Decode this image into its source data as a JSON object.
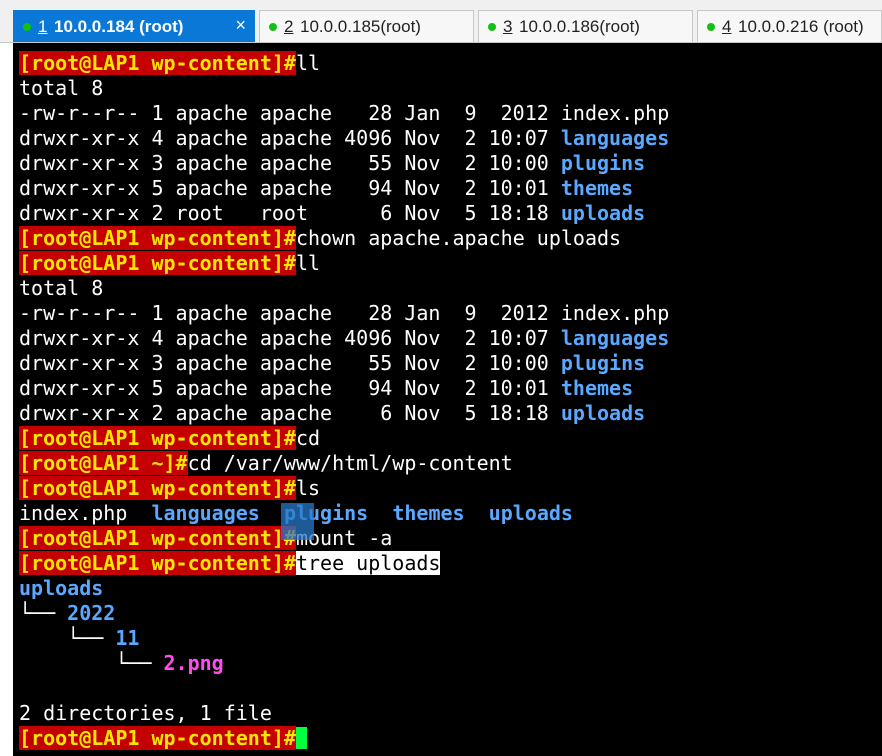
{
  "tabs": [
    {
      "num": "1",
      "title": "10.0.0.184  (root)",
      "active": true,
      "close": "×"
    },
    {
      "num": "2",
      "title": "10.0.0.185(root)",
      "active": false
    },
    {
      "num": "3",
      "title": "10.0.0.186(root)",
      "active": false
    },
    {
      "num": "4",
      "title": "10.0.0.216  (root)",
      "active": false
    }
  ],
  "prompt_wp": "[root@LAP1 wp-content]#",
  "prompt_home": "[root@LAP1 ~]#",
  "cmd1": "ll",
  "total": "total 8",
  "ls1": [
    {
      "perm": "-rw-r--r-- 1 apache apache   28 Jan  9  2012 ",
      "name": "index.php",
      "dir": false
    },
    {
      "perm": "drwxr-xr-x 4 apache apache 4096 Nov  2 10:07 ",
      "name": "languages",
      "dir": true
    },
    {
      "perm": "drwxr-xr-x 3 apache apache   55 Nov  2 10:00 ",
      "name": "plugins",
      "dir": true
    },
    {
      "perm": "drwxr-xr-x 5 apache apache   94 Nov  2 10:01 ",
      "name": "themes",
      "dir": true
    },
    {
      "perm": "drwxr-xr-x 2 root   root      6 Nov  5 18:18 ",
      "name": "uploads",
      "dir": true
    }
  ],
  "cmd2": "chown apache.apache uploads",
  "cmd3": "ll",
  "ls2": [
    {
      "perm": "-rw-r--r-- 1 apache apache   28 Jan  9  2012 ",
      "name": "index.php",
      "dir": false
    },
    {
      "perm": "drwxr-xr-x 4 apache apache 4096 Nov  2 10:07 ",
      "name": "languages",
      "dir": true
    },
    {
      "perm": "drwxr-xr-x 3 apache apache   55 Nov  2 10:00 ",
      "name": "plugins",
      "dir": true
    },
    {
      "perm": "drwxr-xr-x 5 apache apache   94 Nov  2 10:01 ",
      "name": "themes",
      "dir": true
    },
    {
      "perm": "drwxr-xr-x 2 apache apache    6 Nov  5 18:18 ",
      "name": "uploads",
      "dir": true
    }
  ],
  "cmd4": "cd",
  "cmd5": "cd /var/www/html/wp-content",
  "cmd6": "ls",
  "ls_short": {
    "file": "index.php",
    "d1": "languages",
    "d2": "plugins",
    "d3": "themes",
    "d4": "uploads"
  },
  "cmd7": "mount -a",
  "cmd8": "tree uploads",
  "tree": {
    "root": "uploads",
    "b1": "└── ",
    "n1": "2022",
    "b2": "    └── ",
    "n2": "11",
    "b3": "        └── ",
    "n3": "2.png"
  },
  "summary": "2 directories, 1 file"
}
